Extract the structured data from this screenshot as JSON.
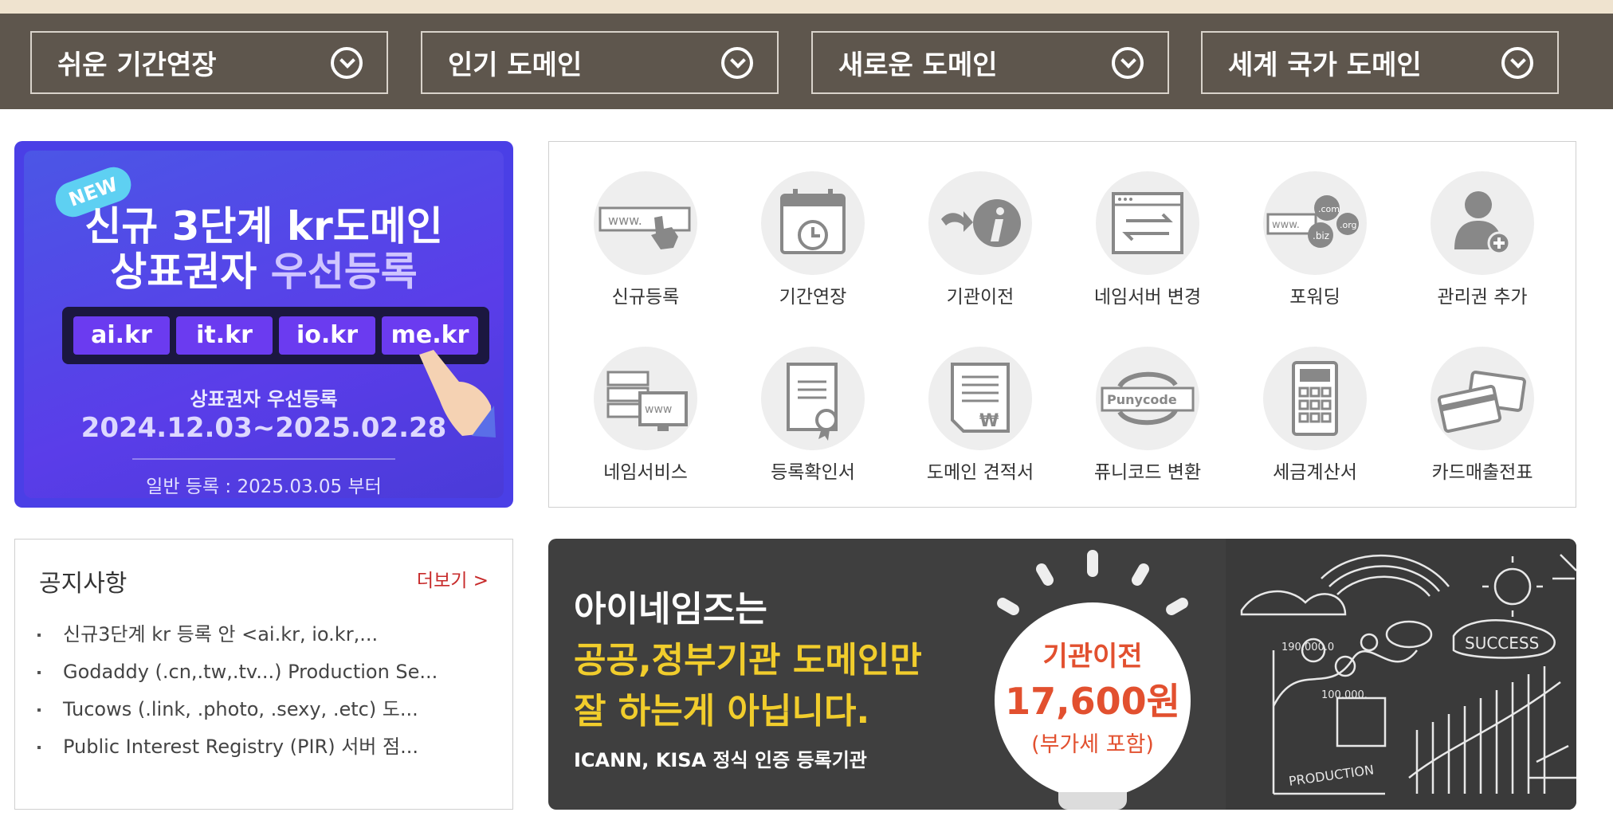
{
  "dropdowns": [
    {
      "label": "쉬운 기간연장"
    },
    {
      "label": "인기 도메인"
    },
    {
      "label": "새로운 도메인"
    },
    {
      "label": "세계 국가 도메인"
    }
  ],
  "promo": {
    "badge": "NEW",
    "title_line1": "신규 3단계 kr도메인",
    "title_line2_plain": "상표권자 ",
    "title_line2_highlight": "우선등록",
    "chips": [
      "ai.kr",
      "it.kr",
      "io.kr",
      "me.kr"
    ],
    "subtitle": "상표권자 우선등록",
    "period": "2024.12.03~2025.02.28",
    "footer": "일반 등록 : 2025.03.05 부터"
  },
  "services": [
    {
      "label": "신규등록",
      "icon": "www-cursor-icon"
    },
    {
      "label": "기간연장",
      "icon": "calendar-clock-icon"
    },
    {
      "label": "기관이전",
      "icon": "transfer-info-icon"
    },
    {
      "label": "네임서버 변경",
      "icon": "window-swap-icon"
    },
    {
      "label": "포워딩",
      "icon": "forwarding-domains-icon"
    },
    {
      "label": "관리권 추가",
      "icon": "user-add-icon"
    },
    {
      "label": "네임서비스",
      "icon": "servers-www-icon"
    },
    {
      "label": "등록확인서",
      "icon": "certificate-icon"
    },
    {
      "label": "도메인 견적서",
      "icon": "quote-document-icon"
    },
    {
      "label": "퓨니코드 변환",
      "icon": "punycode-icon"
    },
    {
      "label": "세금계산서",
      "icon": "calculator-icon"
    },
    {
      "label": "카드매출전표",
      "icon": "credit-card-icon"
    }
  ],
  "punycode_text": "Punycode",
  "notice": {
    "title": "공지사항",
    "more": "더보기 >",
    "items": [
      "신규3단계 kr 등록 안 <ai.kr, io.kr,...",
      "Godaddy (.cn,.tw,.tv...) Production Se...",
      "Tucows (.link, .photo, .sexy, .etc) 도...",
      "Public Interest Registry (PIR) 서버 점..."
    ]
  },
  "banner": {
    "line1": "아이네임즈는",
    "line2": "공공,정부기관 도메인만",
    "line3": "잘 하는게 아닙니다.",
    "sub": "ICANN, KISA 정식 인증 등록기관",
    "bulb_title": "기관이전",
    "bulb_price": "17,600원",
    "bulb_vat": "(부가세 포함)",
    "chalk_success": "SUCCESS",
    "chalk_production": "PRODUCTION",
    "chalk_num1": "190.000.0",
    "chalk_num2": "100.000."
  },
  "colors": {
    "dropbar_bg": "#5e564d",
    "promo_bg": "#4a3fe6",
    "chip_bg": "#6b3bf0",
    "notice_more": "#c72a2a",
    "banner_yellow": "#f1cd2c",
    "price_orange": "#e2502f"
  }
}
